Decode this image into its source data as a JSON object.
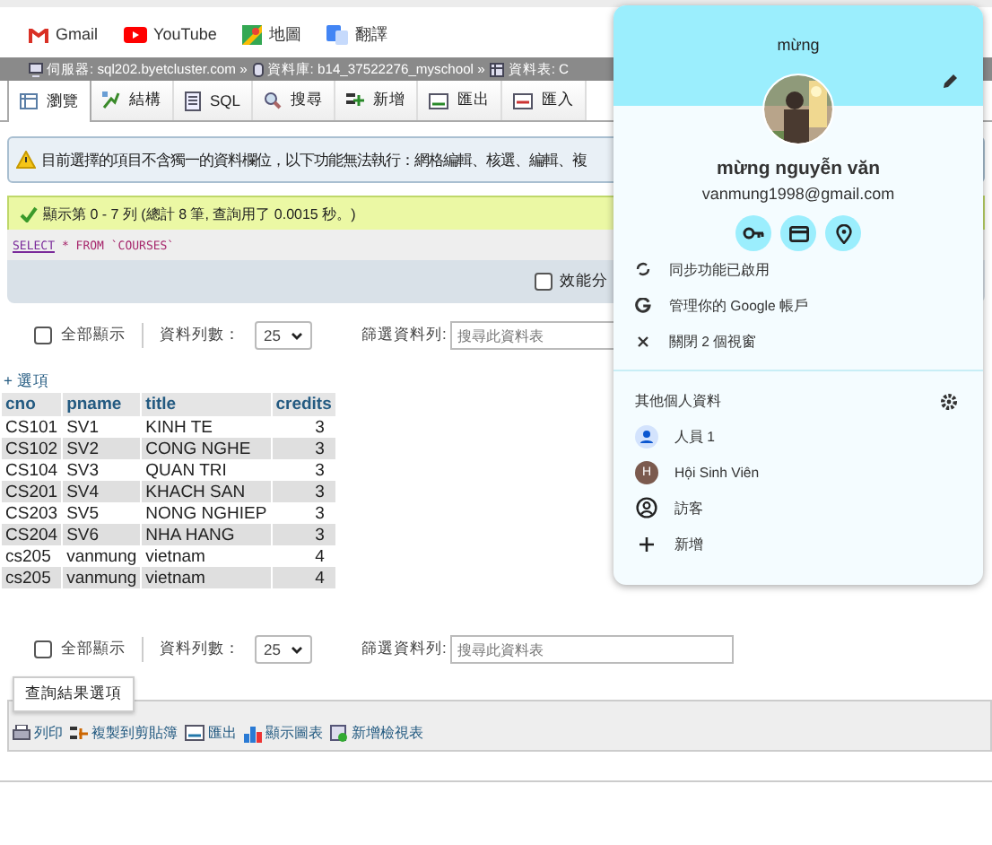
{
  "bookmarks": [
    {
      "label": "Gmail",
      "kind": "gmail"
    },
    {
      "label": "YouTube",
      "kind": "youtube"
    },
    {
      "label": "地圖",
      "kind": "maps"
    },
    {
      "label": "翻譯",
      "kind": "translate"
    }
  ],
  "breadcrumb": [
    {
      "label": "伺服器:",
      "value": "sql202.byetcluster.com »",
      "kind": "server"
    },
    {
      "label": "資料庫:",
      "value": "b14_37522276_myschool »",
      "kind": "database"
    },
    {
      "label": "資料表:",
      "value": "C",
      "kind": "table"
    }
  ],
  "tabs": [
    {
      "label": "瀏覽",
      "kind": "browse",
      "selected": true
    },
    {
      "label": "結構",
      "kind": "structure",
      "selected": false
    },
    {
      "label": "SQL",
      "kind": "sql",
      "selected": false
    },
    {
      "label": "搜尋",
      "kind": "search",
      "selected": false
    },
    {
      "label": "新增",
      "kind": "insert",
      "selected": false
    },
    {
      "label": "匯出",
      "kind": "export",
      "selected": false
    },
    {
      "label": "匯入",
      "kind": "import",
      "selected": false
    }
  ],
  "warning": "目前選擇的項目不含獨一的資料欄位，以下功能無法執行：網格編輯、核選、編輯、複",
  "success": "顯示第 0 - 7 列 (總計 8 筆, 查詢用了 0.0015 秒。)",
  "sql_query": {
    "keyword": "SELECT",
    "rest": "* FROM `COURSES`"
  },
  "profiling": {
    "label": "效能分",
    "checked": false
  },
  "controls": [
    {
      "show_all": "全部顯示",
      "checked": false,
      "rows_label": "資料列數：",
      "rows_value": "25",
      "filter_label": "篩選資料列:",
      "filter_placeholder": "搜尋此資料表"
    },
    {
      "show_all": "全部顯示",
      "checked": false,
      "rows_label": "資料列數：",
      "rows_value": "25",
      "filter_label": "篩選資料列:",
      "filter_placeholder": "搜尋此資料表"
    }
  ],
  "options_link": "+ 選項",
  "table": {
    "columns": [
      "cno",
      "pname",
      "title",
      "credits"
    ],
    "rows": [
      [
        "CS101",
        "SV1",
        "KINH TE",
        "3"
      ],
      [
        "CS102",
        "SV2",
        "CONG NGHE",
        "3"
      ],
      [
        "CS104",
        "SV3",
        "QUAN TRI",
        "3"
      ],
      [
        "CS201",
        "SV4",
        "KHACH SAN",
        "3"
      ],
      [
        "CS203",
        "SV5",
        "NONG NGHIEP",
        "3"
      ],
      [
        "CS204",
        "SV6",
        "NHA HANG",
        "3"
      ],
      [
        "cs205",
        "vanmung",
        "vietnam",
        "4"
      ],
      [
        "cs205",
        "vanmung",
        "vietnam",
        "4"
      ]
    ]
  },
  "tooltip": "查詢結果選項",
  "result_actions": [
    {
      "label": "列印",
      "kind": "print"
    },
    {
      "label": "複製到剪貼簿",
      "kind": "copy"
    },
    {
      "label": "匯出",
      "kind": "export"
    },
    {
      "label": "顯示圖表",
      "kind": "chart"
    },
    {
      "label": "新增檢視表",
      "kind": "view"
    }
  ],
  "profile_menu": {
    "header": "mừng",
    "name": "mừng nguyễn văn",
    "email": "vanmung1998@gmail.com",
    "quick_actions": [
      {
        "kind": "key"
      },
      {
        "kind": "card"
      },
      {
        "kind": "location"
      }
    ],
    "actions": [
      {
        "kind": "sync",
        "label": "同步功能已啟用"
      },
      {
        "kind": "google",
        "label": "管理你的 Google 帳戶"
      },
      {
        "kind": "close",
        "label": "關閉 2 個視窗"
      }
    ],
    "other_profiles_title": "其他個人資料",
    "profiles": [
      {
        "kind": "person",
        "label": "人員 1"
      },
      {
        "kind": "letter",
        "initial": "H",
        "label": "Hội Sinh Viên",
        "color": "#7b5a4e"
      },
      {
        "kind": "guest",
        "label": "訪客"
      },
      {
        "kind": "add",
        "label": "新增"
      }
    ]
  }
}
